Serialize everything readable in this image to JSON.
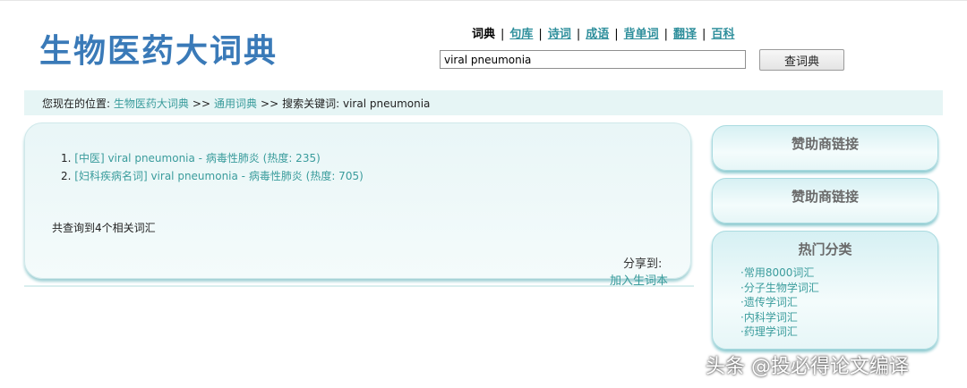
{
  "logo": "生物医药大词典",
  "nav": {
    "current": "词典",
    "links": [
      "句库",
      "诗词",
      "成语",
      "背单词",
      "翻译",
      "百科"
    ],
    "separator": "|"
  },
  "search": {
    "value": "viral pneumonia",
    "button": "查词典"
  },
  "breadcrumb": {
    "prefix": "您现在的位置:",
    "link1": "生物医药大词典",
    "link2": "通用词典",
    "arrow": ">>",
    "keyword_label": "搜索关键词: viral pneumonia"
  },
  "results": [
    {
      "num": "1.",
      "text": "[中医] viral pneumonia - 病毒性肺炎 (热度: 235)"
    },
    {
      "num": "2.",
      "text": "[妇科疾病名词] viral pneumonia - 病毒性肺炎 (热度: 705)"
    }
  ],
  "result_count": "共查询到4个相关词汇",
  "share_label": "分享到:",
  "add_wordbook": "加入生词本",
  "sidebar": {
    "sponsor1": "赞助商链接",
    "sponsor2": "赞助商链接",
    "hot_title": "热门分类",
    "categories": [
      "·常用8000词汇",
      "·分子生物学词汇",
      "·遗传学词汇",
      "·内科学词汇",
      "·药理学词汇"
    ]
  },
  "watermark": "头条 @投必得论文编译",
  "colors": {
    "logo": "#3a7ab8",
    "link": "#3a9c9c",
    "panel": "#e9f6f7"
  }
}
